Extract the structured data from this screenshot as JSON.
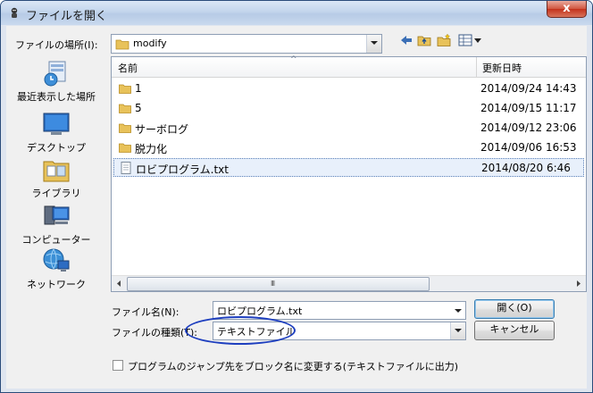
{
  "window": {
    "title": "ファイルを開く",
    "close_label": "x"
  },
  "location": {
    "label": "ファイルの場所(I):",
    "value": "modify"
  },
  "places": [
    {
      "label": "最近表示した場所",
      "icon": "recent-places-icon"
    },
    {
      "label": "デスクトップ",
      "icon": "desktop-icon"
    },
    {
      "label": "ライブラリ",
      "icon": "libraries-icon"
    },
    {
      "label": "コンピューター",
      "icon": "computer-icon"
    },
    {
      "label": "ネットワーク",
      "icon": "network-icon"
    }
  ],
  "list": {
    "col_name": "名前",
    "col_date": "更新日時",
    "rows": [
      {
        "name": "1",
        "date": "2014/09/24 14:43",
        "type": "folder"
      },
      {
        "name": "5",
        "date": "2014/09/15 11:17",
        "type": "folder"
      },
      {
        "name": "サーボログ",
        "date": "2014/09/12 23:06",
        "type": "folder"
      },
      {
        "name": "脱力化",
        "date": "2014/09/06 16:53",
        "type": "folder"
      },
      {
        "name": "ロビプログラム.txt",
        "date": "2014/08/20 6:46",
        "type": "file"
      }
    ],
    "grip": "III"
  },
  "filename": {
    "label": "ファイル名(N):",
    "value": "ロビプログラム.txt"
  },
  "filetype": {
    "label": "ファイルの種類(T):",
    "value": "テキストファイル"
  },
  "buttons": {
    "open": "開く(O)",
    "cancel": "キャンセル"
  },
  "checkbox": {
    "label": "プログラムのジャンプ先をブロック名に変更する(テキストファイルに出力)",
    "checked": false
  },
  "colors": {
    "accent": "#1e3fbf",
    "title_bar": "#c3d5ec",
    "close_button": "#c3321c"
  }
}
